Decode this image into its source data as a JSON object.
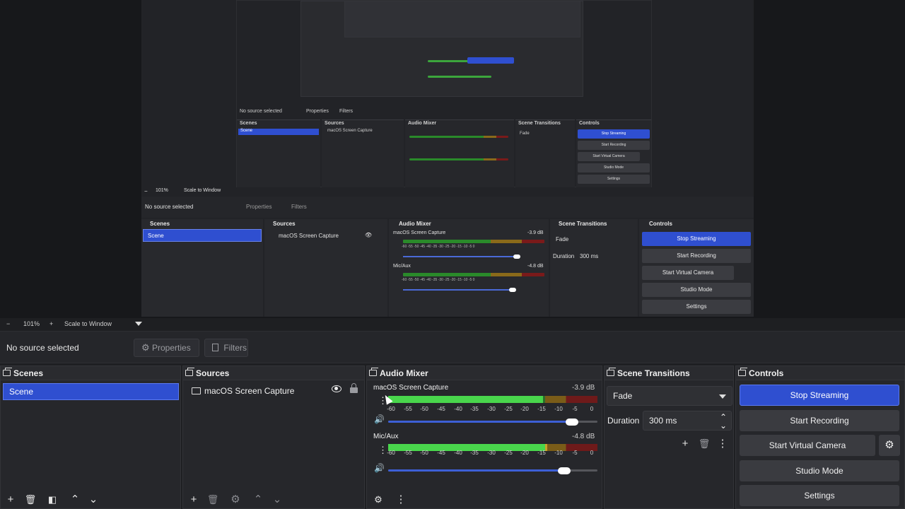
{
  "preview": {
    "mini_scenes_title": "Scenes",
    "mini_sources_title": "Sources",
    "mini_audio_title": "Audio Mixer",
    "mini_transitions_title": "Scene Transitions",
    "mini_controls_title": "Controls",
    "mini_scene_item": "Scene",
    "mini_source_item": "macOS Screen Capture",
    "mini_no_source": "No source selected",
    "mini_properties": "Properties",
    "mini_filters": "Filters",
    "mini_zoom": "101%",
    "mini_scale": "Scale to Window",
    "mini_fade": "Fade",
    "mini_duration": "Duration",
    "mini_duration_value": "300 ms",
    "mini_mic": "Mic/Aux",
    "mini_db1": "-3.9 dB",
    "mini_db2": "-4.8 dB",
    "mini_ticks": "-60 -55 -50 -45 -40 -35 -30 -25 -20 -15 -10 -5 0",
    "mini_buttons": [
      "Stop Streaming",
      "Start Recording",
      "Start Virtual Camera",
      "Studio Mode",
      "Settings"
    ]
  },
  "zoombar": {
    "minus": "−",
    "zoom": "101%",
    "plus": "+",
    "scale_mode": "Scale to Window"
  },
  "sourcebar": {
    "no_source": "No source selected",
    "properties": "Properties",
    "filters": "Filters"
  },
  "scenes": {
    "title": "Scenes",
    "items": [
      "Scene"
    ]
  },
  "sources": {
    "title": "Sources",
    "items": [
      "macOS Screen Capture"
    ]
  },
  "audio_mixer": {
    "title": "Audio Mixer",
    "channels": [
      {
        "name": "macOS Screen Capture",
        "db": "-3.9 dB",
        "level": 0.74,
        "volume": 0.88
      },
      {
        "name": "Mic/Aux",
        "db": "-4.8 dB",
        "level": 0.76,
        "volume": 0.84
      }
    ],
    "ticks": [
      "-60",
      "-55",
      "-50",
      "-45",
      "-40",
      "-35",
      "-30",
      "-25",
      "-20",
      "-15",
      "-10",
      "-5",
      "0"
    ]
  },
  "transitions": {
    "title": "Scene Transitions",
    "selected": "Fade",
    "duration_label": "Duration",
    "duration_value": "300 ms"
  },
  "controls": {
    "title": "Controls",
    "stop_streaming": "Stop Streaming",
    "start_recording": "Start Recording",
    "start_virtual_camera": "Start Virtual Camera",
    "studio_mode": "Studio Mode",
    "settings": "Settings"
  },
  "colors": {
    "accent": "#2f4fd0",
    "background": "#1e1f22",
    "panel": "#26272b",
    "meter_green": "#49d64c",
    "meter_yellow": "#c9a227",
    "meter_red": "#b3262c"
  }
}
